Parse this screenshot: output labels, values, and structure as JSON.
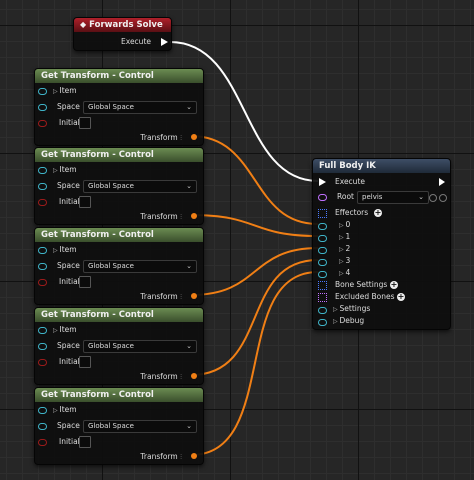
{
  "forwards_solve": {
    "title": "Forwards Solve",
    "execute": "Execute"
  },
  "get_transform_nodes": [
    {
      "title": "Get Transform - Control",
      "item": "Item",
      "space_label": "Space",
      "space_value": "Global Space",
      "initial": "Initial",
      "output": "Transform"
    },
    {
      "title": "Get Transform - Control",
      "item": "Item",
      "space_label": "Space",
      "space_value": "Global Space",
      "initial": "Initial",
      "output": "Transform"
    },
    {
      "title": "Get Transform - Control",
      "item": "Item",
      "space_label": "Space",
      "space_value": "Global Space",
      "initial": "Initial",
      "output": "Transform"
    },
    {
      "title": "Get Transform - Control",
      "item": "Item",
      "space_label": "Space",
      "space_value": "Global Space",
      "initial": "Initial",
      "output": "Transform"
    },
    {
      "title": "Get Transform - Control",
      "item": "Item",
      "space_label": "Space",
      "space_value": "Global Space",
      "initial": "Initial",
      "output": "Transform"
    }
  ],
  "full_body_ik": {
    "title": "Full Body IK",
    "execute": "Execute",
    "root_label": "Root",
    "root_value": "pelvis",
    "effectors_label": "Effectors",
    "effector_items": [
      "0",
      "1",
      "2",
      "3",
      "4"
    ],
    "bone_settings_label": "Bone Settings",
    "excluded_bones_label": "Excluded Bones",
    "settings_label": "Settings",
    "debug_label": "Debug"
  },
  "colors": {
    "exec_wire": "#ffffff",
    "transform_wire": "#f07f15",
    "gt_header": "#5e7c48",
    "fs_header": "#a01c24",
    "fb_header": "#33425a"
  }
}
